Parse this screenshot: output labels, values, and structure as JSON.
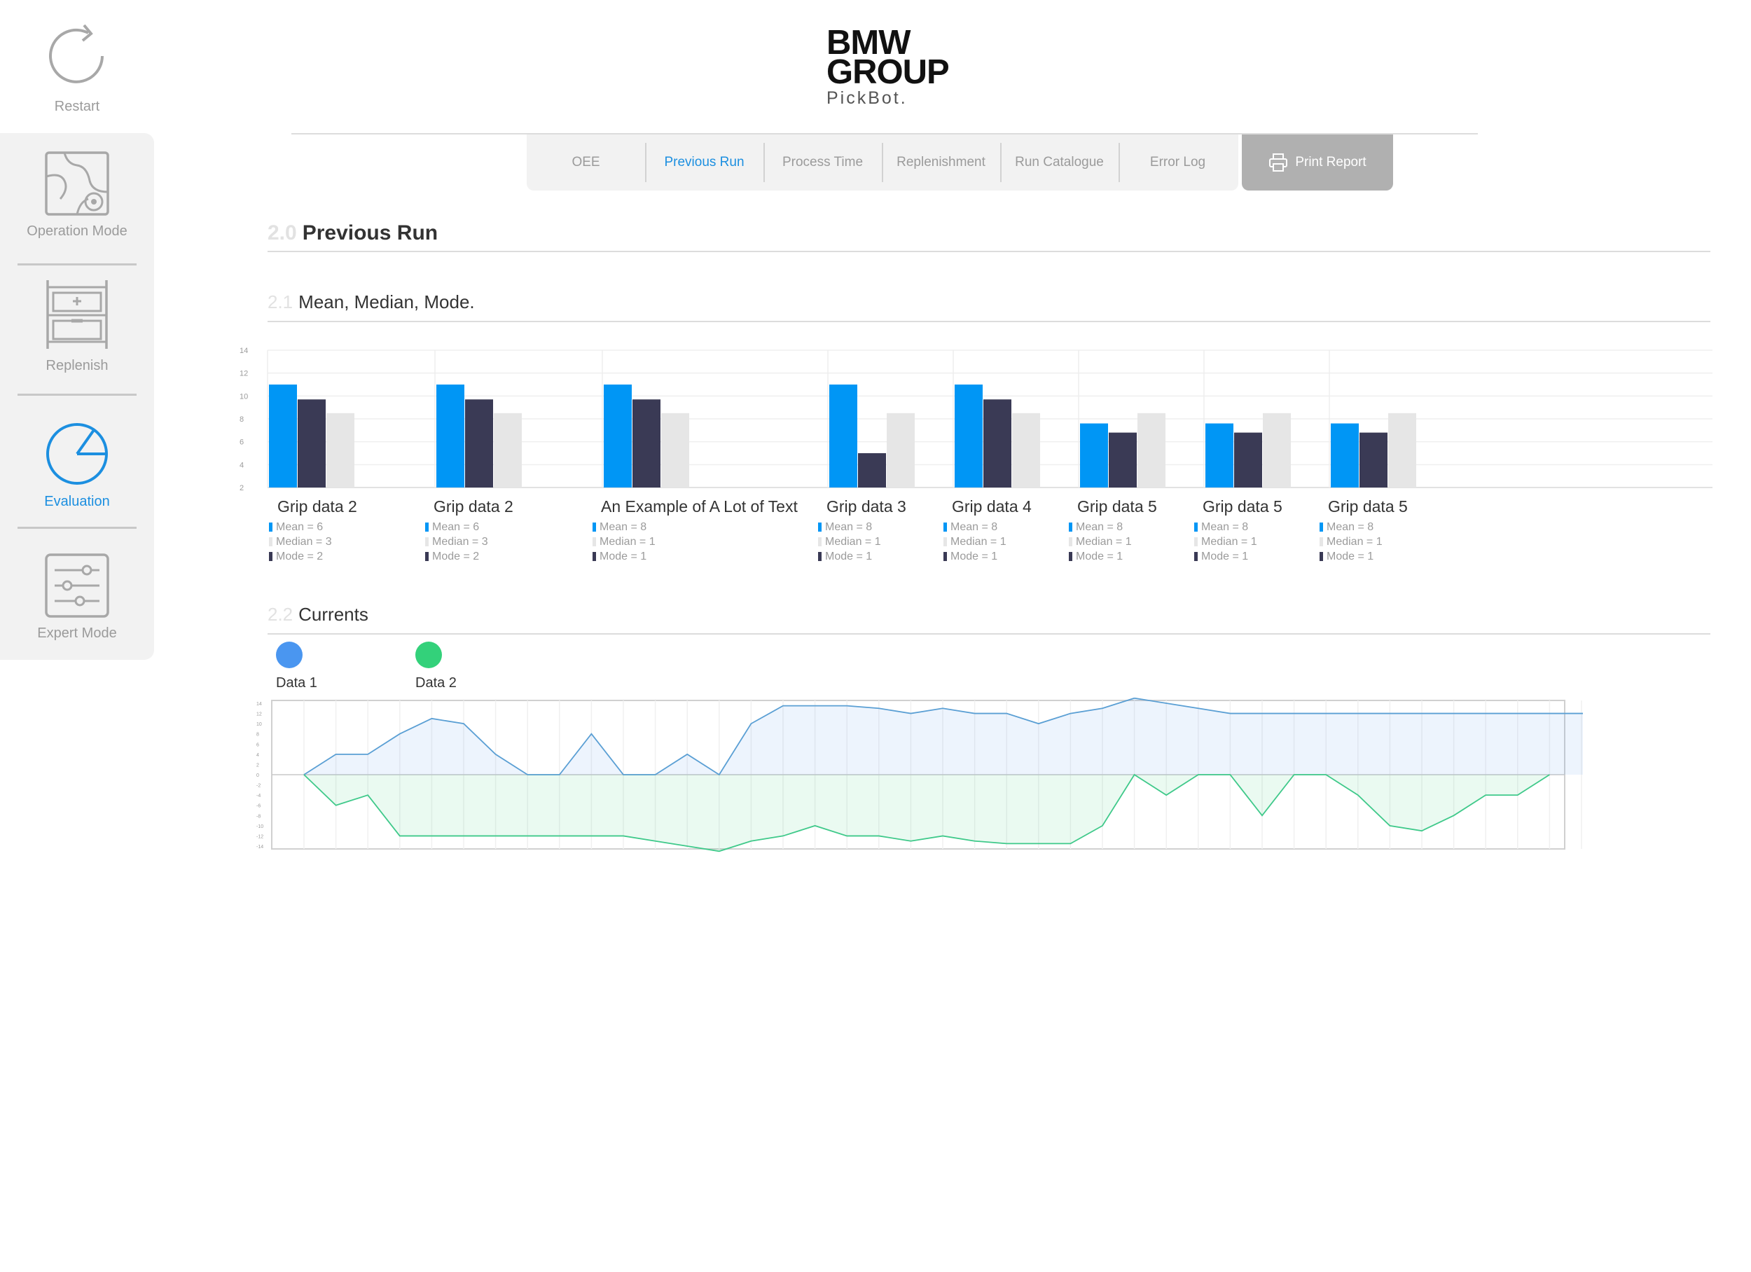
{
  "sidebar": {
    "restart": "Restart",
    "items": [
      {
        "label": "Operation Mode",
        "icon": "operation-mode-icon",
        "active": false
      },
      {
        "label": "Replenish",
        "icon": "replenish-icon",
        "active": false
      },
      {
        "label": "Evaluation",
        "icon": "evaluation-icon",
        "active": true
      },
      {
        "label": "Expert Mode",
        "icon": "expert-mode-icon",
        "active": false
      }
    ]
  },
  "logo": {
    "line1": "BMW",
    "line2": "GROUP",
    "line3": "PickBot."
  },
  "tabs": [
    {
      "label": "OEE",
      "active": false
    },
    {
      "label": "Previous Run",
      "active": true
    },
    {
      "label": "Process Time",
      "active": false
    },
    {
      "label": "Replenishment",
      "active": false
    },
    {
      "label": "Run Catalogue",
      "active": false
    },
    {
      "label": "Error Log",
      "active": false
    }
  ],
  "print_report": "Print Report",
  "sections": {
    "main": {
      "num": "2.0",
      "title": "Previous Run"
    },
    "mmm": {
      "num": "2.1",
      "title": "Mean, Median, Mode."
    },
    "currents": {
      "num": "2.2",
      "title": "Currents"
    }
  },
  "colors": {
    "mean": "#0096f5",
    "median": "#3a3a55",
    "mode": "#e6e6e6",
    "data1": "#4a96f0",
    "data2": "#33d17a",
    "accent": "#1c8fe0"
  },
  "chart_data": [
    {
      "type": "bar",
      "ylim": [
        2,
        14
      ],
      "yticks": [
        "14",
        "12",
        "10",
        "8",
        "6",
        "4",
        "2"
      ],
      "categories": [
        "Grip data 2",
        "Grip data 2",
        "An Example of A Lot of Text",
        "Grip data 3",
        "Grip data 4",
        "Grip data 5",
        "Grip data 5",
        "Grip data 5"
      ],
      "series": [
        {
          "values": [
            11,
            11,
            11,
            11,
            11,
            7.6,
            7.6,
            7.6
          ]
        },
        {
          "values": [
            9.7,
            9.7,
            9.7,
            5,
            9.7,
            6.8,
            6.8,
            6.8
          ]
        },
        {
          "values": [
            8.5,
            8.5,
            8.5,
            8.5,
            8.5,
            8.5,
            8.5,
            8.5
          ]
        }
      ],
      "stats": [
        [
          "Mean = 6",
          "Median = 3",
          "Mode = 2"
        ],
        [
          "Mean = 6",
          "Median = 3",
          "Mode = 2"
        ],
        [
          "Mean = 8",
          "Median = 1",
          "Mode = 1"
        ],
        [
          "Mean = 8",
          "Median = 1",
          "Mode = 1"
        ],
        [
          "Mean = 8",
          "Median = 1",
          "Mode = 1"
        ],
        [
          "Mean = 8",
          "Median = 1",
          "Mode = 1"
        ],
        [
          "Mean = 8",
          "Median = 1",
          "Mode = 1"
        ],
        [
          "Mean = 8",
          "Median = 1",
          "Mode = 1"
        ]
      ],
      "grid": true
    },
    {
      "type": "area",
      "ylim": [
        -14,
        14
      ],
      "yticks": [
        "14",
        "12",
        "10",
        "8",
        "6",
        "4",
        "2",
        "0",
        "-2",
        "-4",
        "-6",
        "-8",
        "-10",
        "-12",
        "-14"
      ],
      "series": [
        {
          "name": "Data 1",
          "values": [
            0,
            4,
            4,
            8,
            11,
            10,
            4,
            0,
            0,
            8,
            0,
            0,
            4,
            0,
            10,
            13.5,
            13.5,
            13.5,
            13,
            12,
            13,
            12,
            12,
            10,
            12,
            13,
            15,
            14,
            13,
            12,
            12,
            12,
            12,
            12,
            12,
            12,
            12,
            12,
            12,
            12,
            12,
            12
          ]
        },
        {
          "name": "Data 2",
          "values": [
            0,
            -6,
            -4,
            -12,
            -12,
            -12,
            -12,
            -12,
            -12,
            -12,
            -12,
            -13,
            -14,
            -15,
            -13,
            -12,
            -10,
            -12,
            -12,
            -13,
            -12,
            -13,
            -13.5,
            -13.5,
            -13.5,
            -10,
            0,
            -4,
            0,
            0,
            -8,
            0,
            0,
            -4,
            -10,
            -11,
            -8,
            -4,
            -4,
            0
          ]
        }
      ],
      "grid": true
    }
  ]
}
